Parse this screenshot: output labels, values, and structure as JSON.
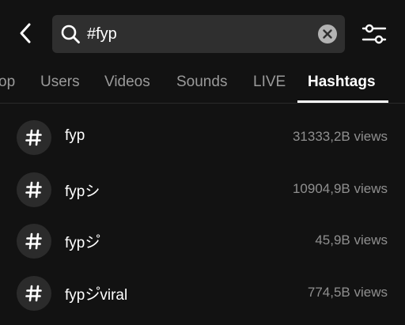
{
  "search": {
    "value": "#fyp",
    "back_icon": "chevron-left-icon",
    "search_icon": "search-icon",
    "clear_icon": "clear-icon",
    "filter_icon": "sliders-icon"
  },
  "tabs": [
    {
      "label": "op",
      "active": false
    },
    {
      "label": "Users",
      "active": false
    },
    {
      "label": "Videos",
      "active": false
    },
    {
      "label": "Sounds",
      "active": false
    },
    {
      "label": "LIVE",
      "active": false
    },
    {
      "label": "Hashtags",
      "active": true
    }
  ],
  "results": [
    {
      "name": "fyp",
      "views": "31333,2B views",
      "icon": "hashtag-icon"
    },
    {
      "name": "fypシ",
      "views": "10904,9B views",
      "icon": "hashtag-icon"
    },
    {
      "name": "fypシ゚",
      "views": "45,9B views",
      "icon": "hashtag-icon"
    },
    {
      "name": "fypシ゚viral",
      "views": "774,5B views",
      "icon": "hashtag-icon"
    }
  ],
  "colors": {
    "background": "#121212",
    "search_bg": "#2f2f2f",
    "muted_text": "#8f8f8f",
    "active_tab": "#ffffff"
  }
}
